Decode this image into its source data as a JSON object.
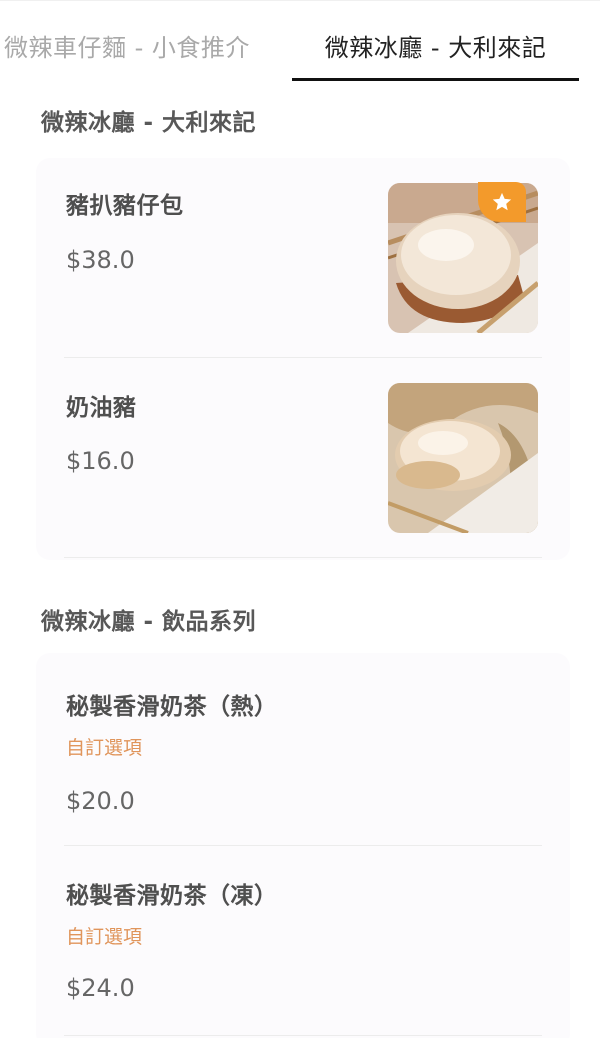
{
  "tabs": [
    {
      "label": "微辣車仔麵 - 小食推介",
      "active": false
    },
    {
      "label": "微辣冰廳 - 大利來記",
      "active": true
    }
  ],
  "sections": [
    {
      "title": "微辣冰廳 - 大利來記",
      "items": [
        {
          "name": "豬扒豬仔包",
          "price": "$38.0",
          "image": "pork-chop-bun-photo",
          "badge": "star-icon"
        },
        {
          "name": "奶油豬",
          "price": "$16.0",
          "image": "butter-bun-photo"
        }
      ]
    },
    {
      "title": "微辣冰廳 - 飲品系列",
      "items": [
        {
          "name": "秘製香滑奶茶（熱）",
          "option": "自訂選項",
          "price": "$20.0"
        },
        {
          "name": "秘製香滑奶茶（凍）",
          "option": "自訂選項",
          "price": "$24.0"
        }
      ]
    }
  ],
  "colors": {
    "accent_option": "#e0955b",
    "badge": "#f39a2b",
    "active_tab_underline": "#111111"
  }
}
